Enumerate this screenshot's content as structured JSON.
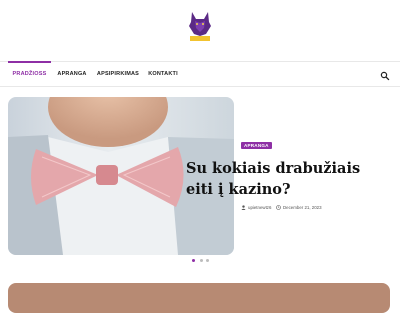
{
  "header": {
    "logo_icon": "wolf-logo"
  },
  "nav": {
    "items": [
      {
        "label": "PRADŽIOSS",
        "active": true
      },
      {
        "label": "APRANGA",
        "active": false
      },
      {
        "label": "APSIPIRKIMAS",
        "active": false
      },
      {
        "label": "KONTAKTI",
        "active": false
      }
    ],
    "search_icon": "search-icon"
  },
  "featured": {
    "category": "APRANGA",
    "title": "Su kokiais drabužiais eiti į kazino?",
    "author": "upietnewtz6",
    "date": "December 21, 2023",
    "author_icon": "user-icon",
    "date_icon": "clock-icon"
  },
  "carousel": {
    "slide_count": 3,
    "active_index": 0
  },
  "colors": {
    "accent": "#8e2fa5",
    "text": "#111111"
  }
}
